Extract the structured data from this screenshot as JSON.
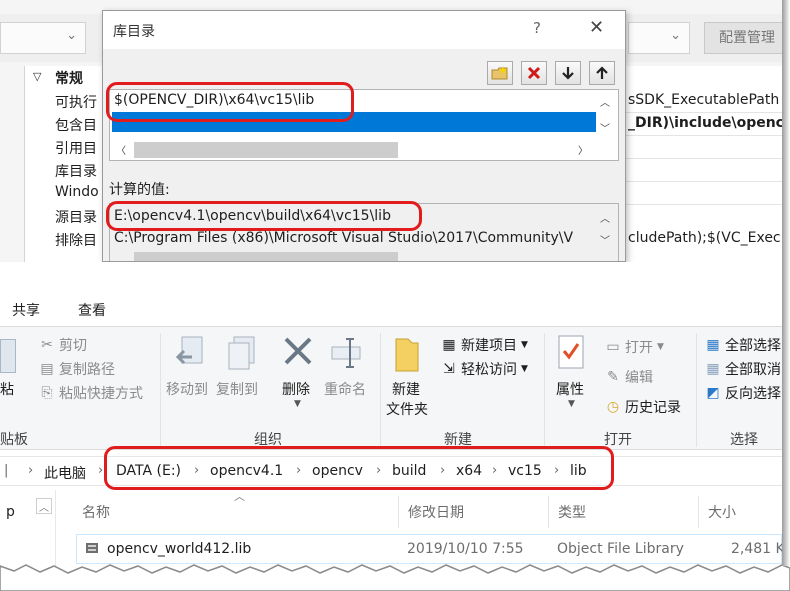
{
  "vs": {
    "config_manager": "配置管理",
    "group": "常规",
    "props": [
      "可执行",
      "包含目",
      "引用目",
      "库目录",
      "Windo",
      "源目录",
      "排除目"
    ],
    "values": [
      "sSDK_ExecutablePath",
      "_DIR)\\include\\openc",
      "cludePath);$(VC_Exec"
    ]
  },
  "dialog": {
    "title": "库目录",
    "help": "?",
    "close": "✕",
    "entry": "$(OPENCV_DIR)\\x64\\vc15\\lib",
    "calc_label": "计算的值:",
    "calc_lines": [
      "E:\\opencv4.1\\opencv\\build\\x64\\vc15\\lib",
      "C:\\Program Files (x86)\\Microsoft Visual Studio\\2017\\Community\\V"
    ]
  },
  "ribbon": {
    "tabs": [
      "共享",
      "查看"
    ],
    "paste_partial": "粘",
    "cut": "剪切",
    "copy_path": "复制路径",
    "paste_shortcut": "粘贴快捷方式",
    "clipboard_partial": "贴板",
    "move_to": "移动到",
    "copy_to": "复制到",
    "delete": "删除",
    "rename": "重命名",
    "organize": "组织",
    "new_item": "新建项目",
    "easy_access": "轻松访问",
    "new_folder_1": "新建",
    "new_folder_2": "文件夹",
    "new_group": "新建",
    "open": "打开",
    "edit": "编辑",
    "history": "历史记录",
    "properties": "属性",
    "open_group": "打开",
    "select_all": "全部选择",
    "select_none": "全部取消",
    "invert": "反向选择",
    "select_group": "选择"
  },
  "address": [
    "此电脑",
    "DATA (E:)",
    "opencv4.1",
    "opencv",
    "build",
    "x64",
    "vc15",
    "lib"
  ],
  "files": {
    "nav_partial": "p",
    "columns": [
      "名称",
      "修改日期",
      "类型",
      "大小"
    ],
    "rows": [
      {
        "name": "opencv_world412.lib",
        "modified": "2019/10/10 7:55",
        "type": "Object File Library",
        "size": "2,481 K"
      }
    ]
  },
  "colors": {
    "highlight": "#e11c1c",
    "selection": "#0078d7",
    "row_hover": "#cce8ff"
  }
}
